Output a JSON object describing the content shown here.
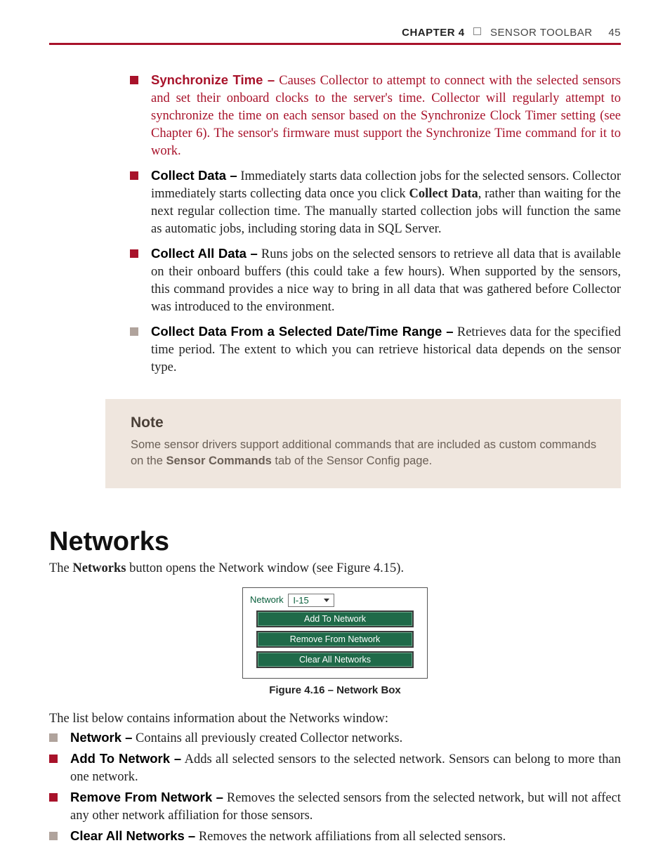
{
  "header": {
    "chapter_label": "CHAPTER 4",
    "chapter_title": "SENSOR TOOLBAR",
    "page_number": "45"
  },
  "list1": [
    {
      "term": "Synchronize Time –",
      "red": true,
      "text": " Causes Collector to attempt to connect with the selected sensors and set their onboard clocks to the server's time. Collector will regularly attempt to synchronize the time on each sensor based on the Synchronize Clock Timer setting (see Chapter 6). The sensor's firmware must support the Synchronize Time command for it to work."
    },
    {
      "term": "Collect Data –",
      "red": true,
      "text_before_strong": " Immediately starts data collection jobs for the selected sensors. Collector immediately starts collecting data once you click ",
      "strong": "Collect Data",
      "text_after_strong": ", rather than waiting for the next regular collection time. The manually started collection jobs will function the same as automatic jobs, including storing data in SQL Server."
    },
    {
      "term": "Collect All Data –",
      "red": true,
      "text": " Runs jobs on the selected sensors to retrieve all data that is available on their onboard buffers (this could take a few hours). When supported by the sensors, this command provides a nice way to bring in all data that was gathered before Collector was introduced to the environment."
    },
    {
      "term": "Collect Data From a Selected Date/Time Range –",
      "grey": true,
      "text": " Retrieves data for the specified time period. The extent to which you can retrieve historical data depends on the sensor type."
    }
  ],
  "note": {
    "title": "Note",
    "body_before": "Some sensor drivers support additional commands that are included as custom commands on the ",
    "bold": "Sensor Commands",
    "body_after": " tab of the Sensor Config page."
  },
  "section_title": "Networks",
  "lead_before": "The ",
  "lead_bold": "Networks",
  "lead_after": " button opens the Network window (see Figure 4.15).",
  "figure": {
    "network_label": "Network",
    "network_value": "I-15",
    "btn_add": "Add To Network",
    "btn_remove": "Remove From Network",
    "btn_clear": "Clear All Networks",
    "caption": "Figure 4.16 – Network Box"
  },
  "para2": "The list below contains information about the Networks window:",
  "list2": [
    {
      "term": "Network –",
      "grey": true,
      "text": " Contains all previously created Collector networks."
    },
    {
      "term": "Add To Network –",
      "red": true,
      "text": " Adds all selected sensors to the selected network. Sensors can belong to more than one network."
    },
    {
      "term": "Remove From Network –",
      "red": true,
      "text": " Removes the selected sensors from the selected network, but will not affect any other network affiliation for those sensors."
    },
    {
      "term": "Clear All Networks –",
      "grey": true,
      "text": " Removes the network affiliations from all selected sensors."
    }
  ]
}
